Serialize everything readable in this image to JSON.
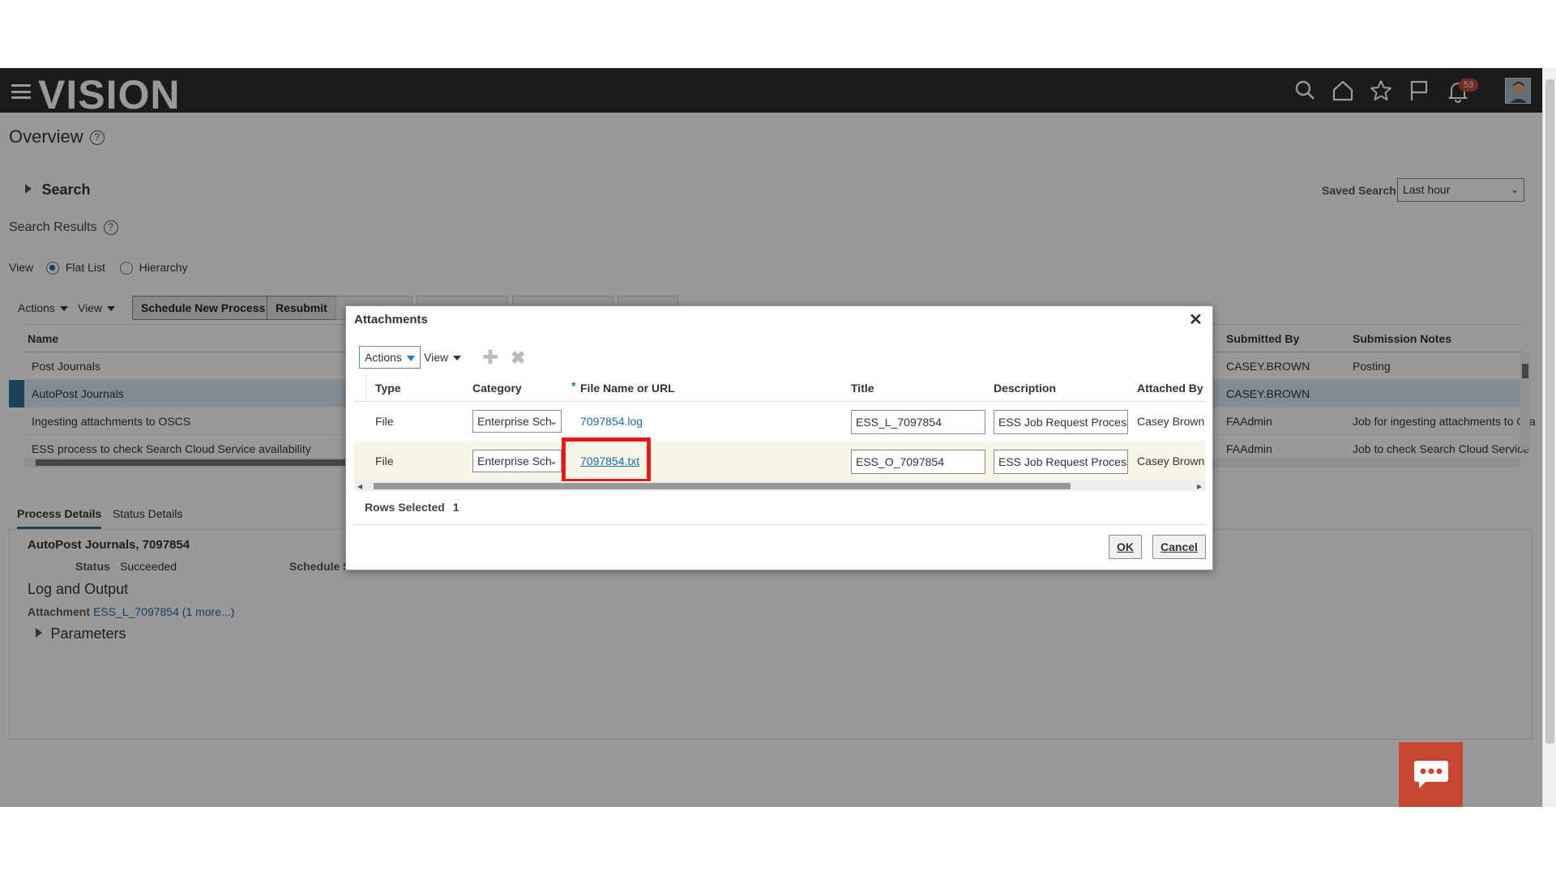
{
  "app": {
    "logo": "VISION",
    "notification_count": "53"
  },
  "header_icons": [
    "menu-icon",
    "search-icon",
    "home-icon",
    "star-icon",
    "flag-icon",
    "bell-icon",
    "avatar"
  ],
  "page": {
    "title": "Overview",
    "search_label": "Search",
    "saved_search_label": "Saved Search",
    "saved_search_value": "Last hour",
    "results_label": "Search Results",
    "view_label": "View",
    "view_flat": "Flat List",
    "view_hierarchy": "Hierarchy"
  },
  "toolbar": {
    "actions": "Actions",
    "view": "View",
    "schedule": "Schedule New Process",
    "resubmit": "Resubmit"
  },
  "grid": {
    "headers": {
      "name": "Name",
      "submitted_by": "Submitted By",
      "notes": "Submission Notes"
    },
    "rows": [
      {
        "name": "Post Journals",
        "submitted_by": "CASEY.BROWN",
        "notes": "Posting"
      },
      {
        "name": "AutoPost Journals",
        "submitted_by": "CASEY.BROWN",
        "notes": ""
      },
      {
        "name": "Ingesting attachments to OSCS",
        "submitted_by": "FAAdmin",
        "notes": "Job for ingesting attachments to Ora"
      },
      {
        "name": "ESS process to check Search Cloud Service availability",
        "submitted_by": "FAAdmin",
        "notes": "Job to check Search Cloud Service"
      }
    ]
  },
  "tabs": {
    "process_details": "Process Details",
    "status_details": "Status Details"
  },
  "details": {
    "heading": "AutoPost Journals, 7097854",
    "status_label": "Status",
    "status_value": "Succeeded",
    "schedule_label": "Schedule S",
    "log_output": "Log and Output",
    "attachment_label": "Attachment",
    "attachment_link": "ESS_L_7097854",
    "attachment_more": "(1 more...)",
    "parameters": "Parameters"
  },
  "dialog": {
    "title": "Attachments",
    "actions": "Actions",
    "view": "View",
    "headers": {
      "type": "Type",
      "category": "Category",
      "required": "*",
      "file": "File Name or URL",
      "title": "Title",
      "description": "Description",
      "attached_by": "Attached By"
    },
    "rows": [
      {
        "type": "File",
        "category": "Enterprise Sch",
        "file": "7097854.log",
        "title": "ESS_L_7097854",
        "description": "ESS Job Request Process",
        "attached_by": "Casey Brown"
      },
      {
        "type": "File",
        "category": "Enterprise Sch",
        "file": "7097854.txt",
        "title": "ESS_O_7097854",
        "description": "ESS Job Request Process",
        "attached_by": "Casey Brown"
      }
    ],
    "rows_selected_label": "Rows Selected",
    "rows_selected_value": "1",
    "ok": "OK",
    "cancel": "Cancel"
  },
  "colors": {
    "header_bg": "#2d2d2d",
    "link": "#1b6aa8",
    "highlight": "#e31b1b",
    "badge": "#c74634"
  }
}
